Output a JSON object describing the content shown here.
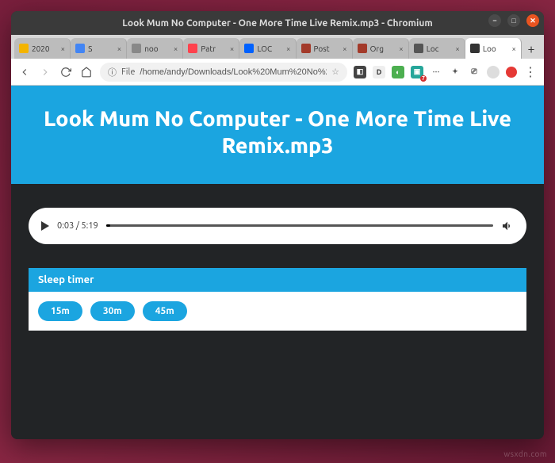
{
  "window": {
    "title": "Look Mum No Computer - One More Time Live Remix.mp3 - Chromium"
  },
  "tabs": [
    {
      "label": "2020",
      "favColor": "#f4b400"
    },
    {
      "label": "S",
      "favColor": "#4285f4"
    },
    {
      "label": "noo",
      "favColor": "#888888"
    },
    {
      "label": "Patr",
      "favColor": "#ff424d"
    },
    {
      "label": "LOC",
      "favColor": "#0061fe"
    },
    {
      "label": "Post",
      "favColor": "#a33a2a"
    },
    {
      "label": "Org",
      "favColor": "#a33a2a"
    },
    {
      "label": "Loc",
      "favColor": "#555555"
    },
    {
      "label": "Loo",
      "favColor": "#333333",
      "active": true
    }
  ],
  "toolbar": {
    "file_chip": "File",
    "url": "/home/andy/Downloads/Look%20Mum%20No%2…"
  },
  "hero": {
    "title": "Look Mum No Computer - One More Time Live Remix.mp3"
  },
  "player": {
    "current": "0:03",
    "duration": "5:19"
  },
  "sleep": {
    "header": "Sleep timer",
    "options": [
      "15m",
      "30m",
      "45m"
    ]
  },
  "watermark": "wsxdn.com"
}
